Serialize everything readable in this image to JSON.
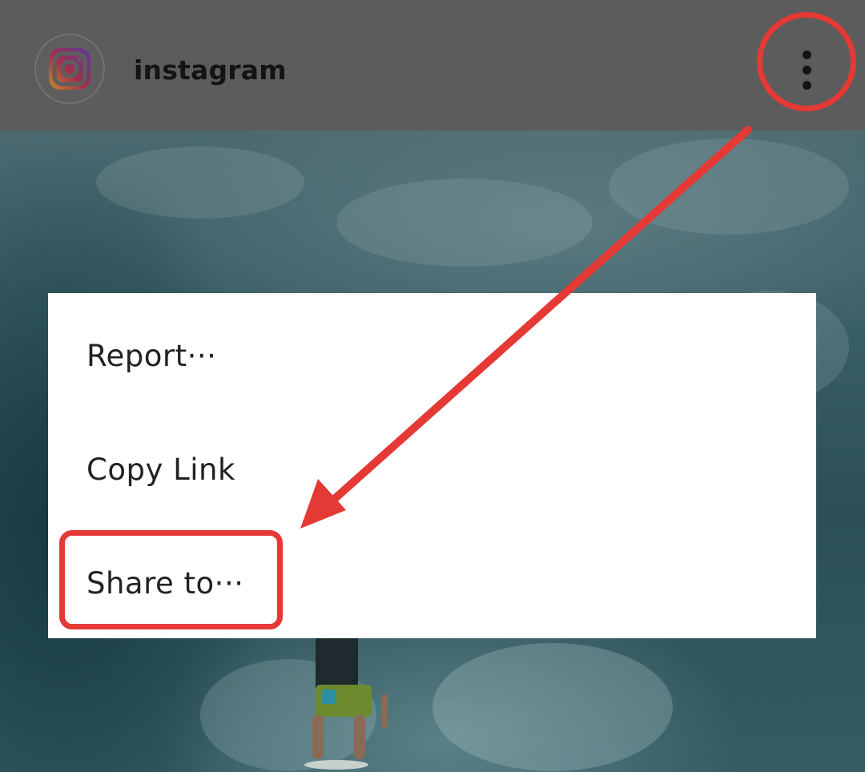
{
  "header": {
    "username": "instagram",
    "avatar_icon": "instagram-logo-icon",
    "more_icon": "vertical-dots-icon"
  },
  "menu": {
    "items": [
      {
        "label": "Report···"
      },
      {
        "label": "Copy Link"
      },
      {
        "label": "Share to···"
      }
    ]
  },
  "annotations": {
    "color": "#e53935",
    "highlight_targets": [
      "more-options-button",
      "menu-item-share-to"
    ]
  },
  "colors": {
    "dim_header": "#5c5c5c",
    "menu_background": "#ffffff",
    "menu_text": "#222222"
  }
}
